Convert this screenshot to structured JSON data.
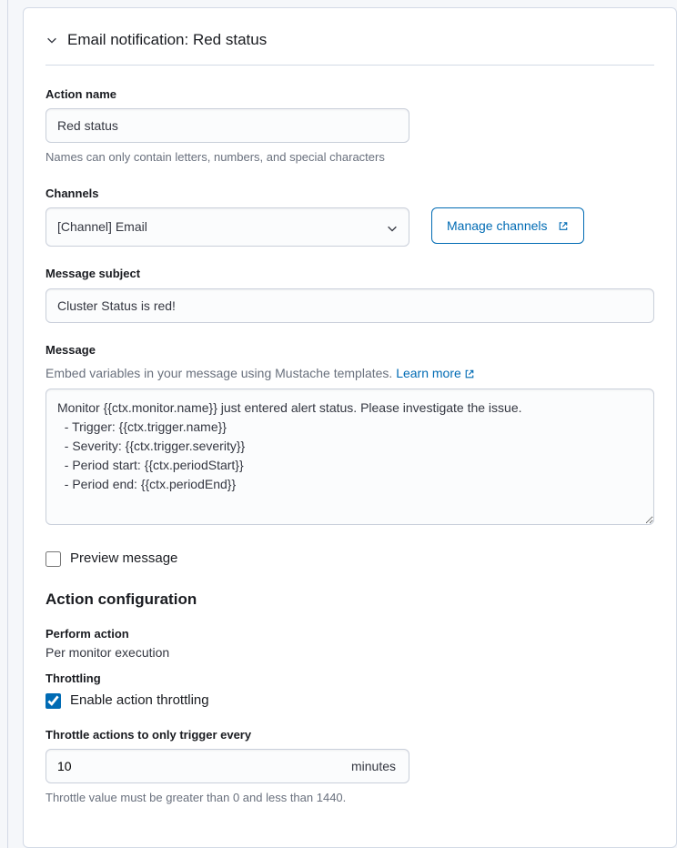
{
  "header": {
    "title": "Email notification: Red status"
  },
  "actionName": {
    "label": "Action name",
    "value": "Red status",
    "help": "Names can only contain letters, numbers, and special characters"
  },
  "channels": {
    "label": "Channels",
    "selected": "[Channel] Email",
    "manageButton": "Manage channels"
  },
  "messageSubject": {
    "label": "Message subject",
    "value": "Cluster Status is red!"
  },
  "message": {
    "label": "Message",
    "helpPrefix": "Embed variables in your message using Mustache templates. ",
    "learnMore": "Learn more",
    "value": "Monitor {{ctx.monitor.name}} just entered alert status. Please investigate the issue.\n  - Trigger: {{ctx.trigger.name}}\n  - Severity: {{ctx.trigger.severity}}\n  - Period start: {{ctx.periodStart}}\n  - Period end: {{ctx.periodEnd}}"
  },
  "previewCheckbox": {
    "label": "Preview message",
    "checked": false
  },
  "actionConfig": {
    "title": "Action configuration",
    "performAction": {
      "label": "Perform action",
      "value": "Per monitor execution"
    },
    "throttling": {
      "label": "Throttling",
      "enableLabel": "Enable action throttling",
      "enabled": true
    },
    "throttleInterval": {
      "label": "Throttle actions to only trigger every",
      "value": "10",
      "suffix": "minutes",
      "help": "Throttle value must be greater than 0 and less than 1440."
    }
  }
}
